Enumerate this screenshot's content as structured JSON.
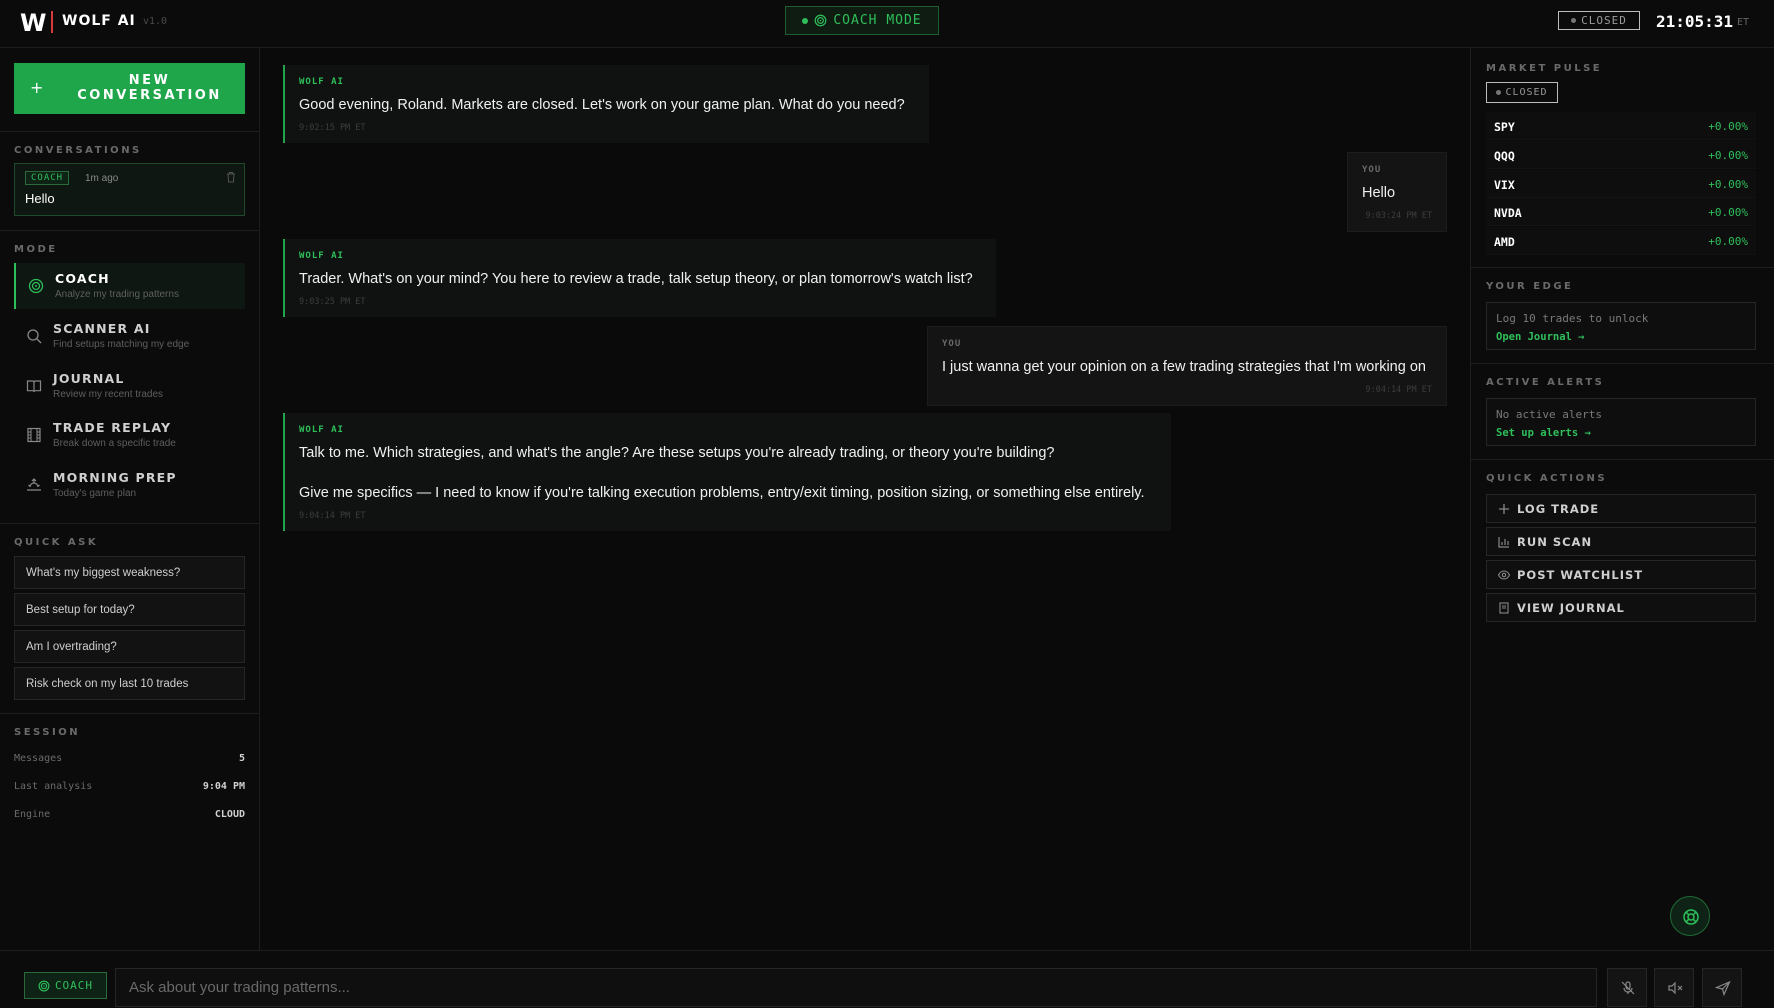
{
  "header": {
    "logo_mark": "W",
    "app_name": "WOLF AI",
    "version": "v1.0",
    "mode_label": "COACH MODE",
    "market_status": "CLOSED",
    "clock": "21:05:31",
    "timezone": "ET"
  },
  "sidebar": {
    "new_conversation_label": "NEW CONVERSATION",
    "conversations_heading": "CONVERSATIONS",
    "conversations": [
      {
        "tag": "COACH",
        "time": "1m ago",
        "title": "Hello"
      }
    ],
    "mode_heading": "MODE",
    "modes": [
      {
        "title": "COACH",
        "subtitle": "Analyze my trading patterns",
        "icon": "target-icon",
        "active": true
      },
      {
        "title": "SCANNER AI",
        "subtitle": "Find setups matching my edge",
        "icon": "search-icon",
        "active": false
      },
      {
        "title": "JOURNAL",
        "subtitle": "Review my recent trades",
        "icon": "book-icon",
        "active": false
      },
      {
        "title": "TRADE REPLAY",
        "subtitle": "Break down a specific trade",
        "icon": "film-icon",
        "active": false
      },
      {
        "title": "MORNING PREP",
        "subtitle": "Today's game plan",
        "icon": "sunrise-icon",
        "active": false
      }
    ],
    "quick_ask_heading": "QUICK ASK",
    "quick_ask": [
      "What's my biggest weakness?",
      "Best setup for today?",
      "Am I overtrading?",
      "Risk check on my last 10 trades"
    ],
    "session_heading": "SESSION",
    "session": [
      {
        "label": "Messages",
        "value": "5"
      },
      {
        "label": "Last analysis",
        "value": "9:04 PM"
      },
      {
        "label": "Engine",
        "value": "CLOUD"
      }
    ]
  },
  "chat": {
    "messages": [
      {
        "role": "ai",
        "label": "WOLF AI",
        "paragraphs": [
          "Good evening, Roland. Markets are closed. Let's work on your game plan. What do you need?"
        ],
        "time": "9:02:15 PM ET"
      },
      {
        "role": "user",
        "label": "YOU",
        "paragraphs": [
          "Hello"
        ],
        "time": "9:03:24 PM ET"
      },
      {
        "role": "ai",
        "label": "WOLF AI",
        "paragraphs": [
          "Trader. What's on your mind? You here to review a trade, talk setup theory, or plan tomorrow's watch list?"
        ],
        "time": "9:03:25 PM ET"
      },
      {
        "role": "user",
        "label": "YOU",
        "paragraphs": [
          "I just wanna get your opinion on a few trading strategies that I'm working on"
        ],
        "time": "9:04:14 PM ET"
      },
      {
        "role": "ai",
        "label": "WOLF AI",
        "paragraphs": [
          "Talk to me. Which strategies, and what's the angle? Are these setups you're already trading, or theory you're building?",
          "Give me specifics — I need to know if you're talking execution problems, entry/exit timing, position sizing, or something else entirely."
        ],
        "time": "9:04:14 PM ET"
      }
    ]
  },
  "right": {
    "market_pulse_heading": "MARKET PULSE",
    "market_status": "CLOSED",
    "tickers": [
      {
        "symbol": "SPY",
        "change": "+0.00%"
      },
      {
        "symbol": "QQQ",
        "change": "+0.00%"
      },
      {
        "symbol": "VIX",
        "change": "+0.00%"
      },
      {
        "symbol": "NVDA",
        "change": "+0.00%"
      },
      {
        "symbol": "AMD",
        "change": "+0.00%"
      }
    ],
    "your_edge_heading": "YOUR EDGE",
    "your_edge_text": "Log 10 trades to unlock",
    "your_edge_link": "Open Journal →",
    "alerts_heading": "ACTIVE ALERTS",
    "alerts_text": "No active alerts",
    "alerts_link": "Set up alerts →",
    "quick_actions_heading": "QUICK ACTIONS",
    "quick_actions": [
      {
        "label": "LOG TRADE",
        "icon": "plus-icon"
      },
      {
        "label": "RUN SCAN",
        "icon": "bar-chart-icon"
      },
      {
        "label": "POST WATCHLIST",
        "icon": "eye-icon"
      },
      {
        "label": "VIEW JOURNAL",
        "icon": "notebook-icon"
      }
    ]
  },
  "input": {
    "mode_chip": "COACH",
    "placeholder": "Ask about your trading patterns..."
  },
  "colors": {
    "accent": "#1fa64a",
    "background": "#0a0a0a",
    "positive": "#2fbf5a"
  }
}
